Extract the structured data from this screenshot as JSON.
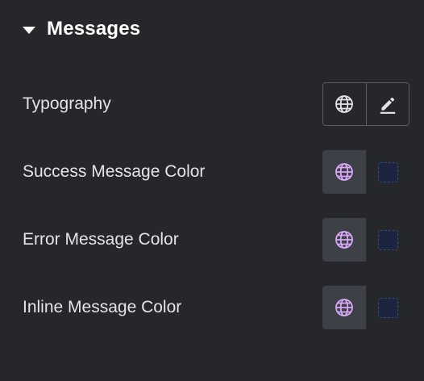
{
  "section": {
    "title": "Messages",
    "expanded": true
  },
  "rows": [
    {
      "label": "Typography",
      "controls": [
        "globe-icon",
        "pencil-icon"
      ],
      "style": "outlined"
    },
    {
      "label": "Success Message Color",
      "controls": [
        "globe-icon",
        "color-swatch"
      ],
      "style": "filled",
      "swatch_color": "#1b2540"
    },
    {
      "label": "Error Message Color",
      "controls": [
        "globe-icon",
        "color-swatch"
      ],
      "style": "filled",
      "swatch_color": "#1b2540"
    },
    {
      "label": "Inline Message Color",
      "controls": [
        "globe-icon",
        "color-swatch"
      ],
      "style": "filled",
      "swatch_color": "#1b2540"
    }
  ],
  "colors": {
    "background": "#26272b",
    "text": "#e3e4e8",
    "title": "#ffffff",
    "globe_default": "#e3e4e8",
    "globe_active": "#d6a8f5",
    "control_fill": "#3e4047",
    "control_border": "#5a5c63"
  }
}
